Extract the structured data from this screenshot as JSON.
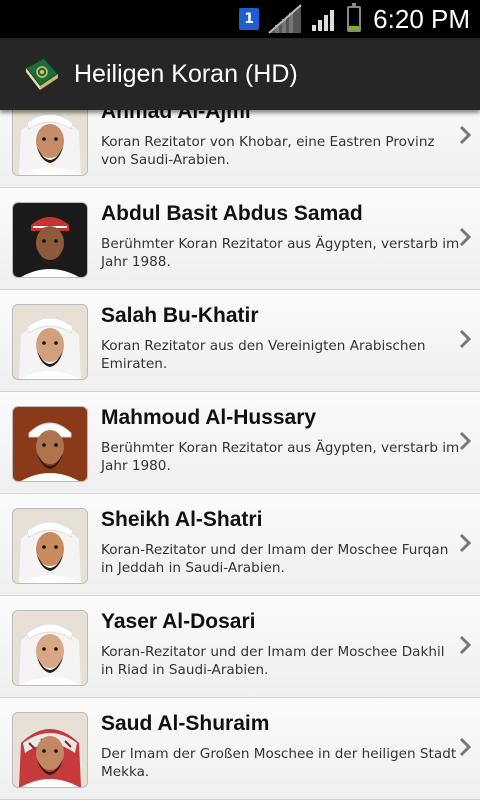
{
  "status_bar": {
    "notification_count": "1",
    "time": "6:20 PM",
    "battery_level": 0.2,
    "icons": [
      "notification-badge-icon",
      "no-signal-icon",
      "signal-bars-icon",
      "battery-icon"
    ]
  },
  "action_bar": {
    "title": "Heiligen Koran (HD)",
    "icon": "quran-book-icon"
  },
  "reciters": [
    {
      "name": "Ahmad Al-Ajmi",
      "description": "Koran Rezitator von Khobar, eine Eastren Provinz von Saudi-Arabien.",
      "headwear": "white",
      "skin": "#c58c68"
    },
    {
      "name": "Abdul Basit Abdus Samad",
      "description": "Berühmter Koran Rezitator aus Ägypten, verstarb im Jahr 1988.",
      "headwear": "dark",
      "skin": "#8d5a3c"
    },
    {
      "name": "Salah Bu-Khatir",
      "description": "Koran Rezitator aus den Vereinigten Arabischen Emiraten.",
      "headwear": "white",
      "skin": "#d3a07d"
    },
    {
      "name": "Mahmoud Al-Hussary",
      "description": "Berühmter Koran Rezitator aus Ägypten, verstarb im Jahr 1980.",
      "headwear": "whitecap",
      "skin": "#b07350"
    },
    {
      "name": "Sheikh Al-Shatri",
      "description": "Koran-Rezitator und der Imam der Moschee Furqan in Jeddah in Saudi-Arabien.",
      "headwear": "white",
      "skin": "#c98a5e"
    },
    {
      "name": "Yaser Al-Dosari",
      "description": "Koran-Rezitator und der Imam der Moschee Dakhil in Riad in Saudi-Arabien.",
      "headwear": "white",
      "skin": "#d8a884"
    },
    {
      "name": "Saud Al-Shuraim",
      "description": "Der Imam der Großen Moschee in der heiligen Stadt Mekka.",
      "headwear": "red",
      "skin": "#c48763"
    }
  ],
  "colors": {
    "action_bar": "#262626",
    "status_bar": "#000000",
    "list_bg": "#f2f2f2",
    "battery": "#7ab51d",
    "notification": "#1e5fcf"
  }
}
